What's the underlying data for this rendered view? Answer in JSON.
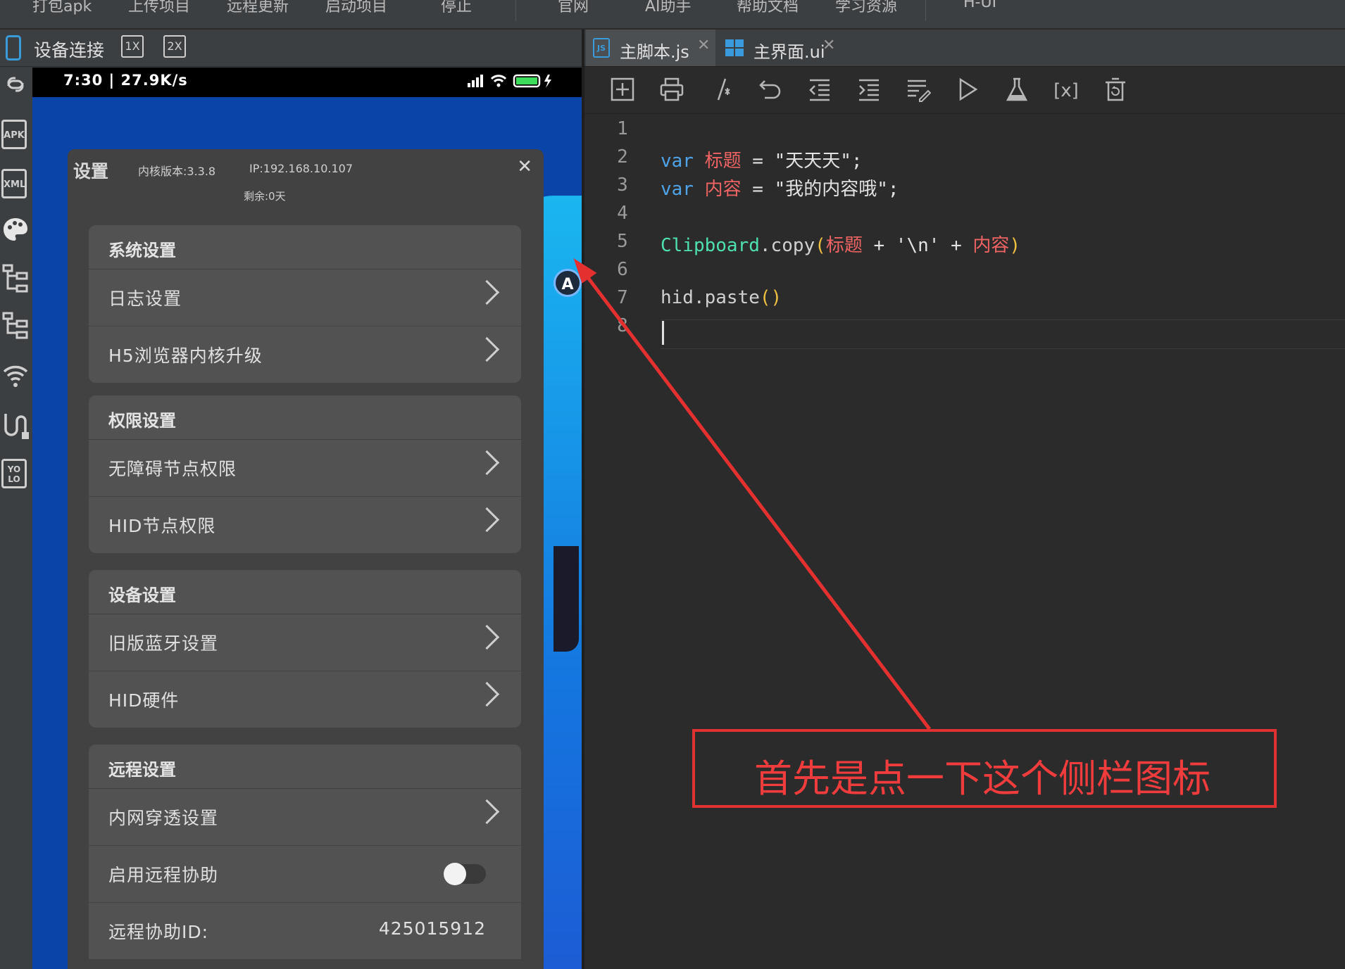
{
  "menu": {
    "items": [
      "打包apk",
      "上传项目",
      "远程更新",
      "启动项目",
      "停止",
      "官网",
      "AI助手",
      "帮助文档",
      "学习资源",
      "H-UI"
    ]
  },
  "device_panel": {
    "title": "设备连接",
    "scale_1x": "1X",
    "scale_2x": "2X",
    "tools": {
      "apk": "APK",
      "xml": "XML",
      "yolo": "YO LO"
    }
  },
  "phone": {
    "status_time": "7:30 | 27.9K/s",
    "settings": {
      "title": "设置",
      "kernel_version": "内核版本:3.3.8",
      "ip": "IP:192.168.10.107",
      "remaining": "剩余:0天",
      "groups": [
        {
          "header": "系统设置",
          "rows": [
            "日志设置",
            "H5浏览器内核升级"
          ]
        },
        {
          "header": "权限设置",
          "rows": [
            "无障碍节点权限",
            "HID节点权限"
          ]
        },
        {
          "header": "设备设置",
          "rows": [
            "旧版蓝牙设置",
            "HID硬件"
          ]
        },
        {
          "header": "远程设置",
          "rows": [
            "内网穿透设置",
            "启用远程协助",
            "远程协助ID:"
          ]
        }
      ],
      "remote_id": "425015912",
      "remote_assist_enabled": false
    }
  },
  "editor": {
    "tabs": [
      {
        "label": "主脚本.js",
        "active": true
      },
      {
        "label": "主界面.ui",
        "active": false
      }
    ],
    "line_numbers": [
      "1",
      "2",
      "3",
      "4",
      "5",
      "6",
      "7",
      "8"
    ],
    "code": {
      "l2_kw": "var",
      "l2_name": "标题",
      "l2_rest": " = \"天天天\";",
      "l3_kw": "var",
      "l3_name": "内容",
      "l3_rest": " = \"我的内容哦\";",
      "l5_fn": "Clipboard",
      "l5_method": ".copy",
      "l5_open": "(",
      "l5_a": "标题",
      "l5_mid": " + '\\n' + ",
      "l5_b": "内容",
      "l5_close": ")",
      "l7_call": "hid.paste",
      "l7_parens": "()"
    }
  },
  "annotation": {
    "text": "首先是点一下这个侧栏图标",
    "color": "#e03232"
  }
}
